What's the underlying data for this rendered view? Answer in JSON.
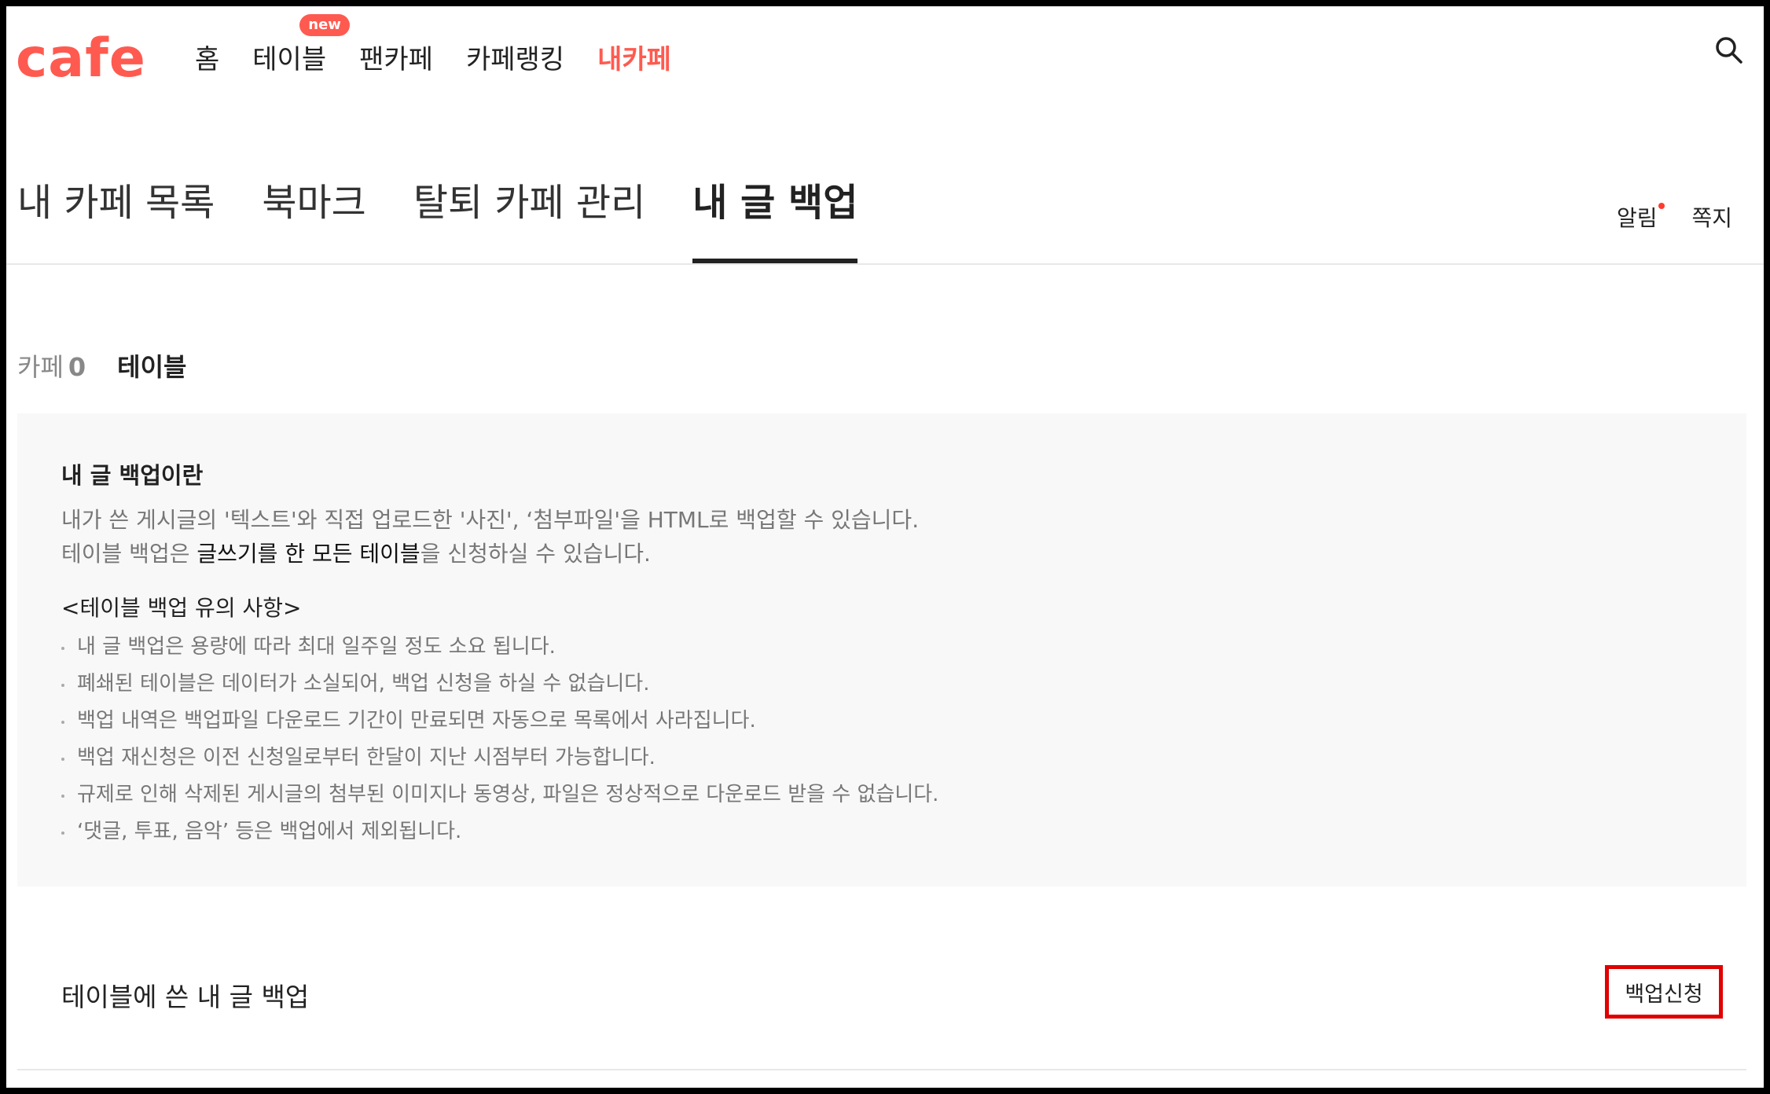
{
  "header": {
    "logo": "cafe",
    "nav": [
      {
        "label": "홈",
        "name": "nav-home"
      },
      {
        "label": "테이블",
        "name": "nav-table",
        "badge": "new"
      },
      {
        "label": "팬카페",
        "name": "nav-fancafe"
      },
      {
        "label": "카페랭킹",
        "name": "nav-cafe-ranking"
      },
      {
        "label": "내카페",
        "name": "nav-my-cafe",
        "active": true
      }
    ],
    "search_icon": "search-icon"
  },
  "tabs": [
    {
      "label": "내 카페 목록"
    },
    {
      "label": "북마크"
    },
    {
      "label": "탈퇴 카페 관리"
    },
    {
      "label": "내 글 백업",
      "active": true
    }
  ],
  "util": {
    "notice": "알림",
    "message": "쪽지"
  },
  "subtabs": {
    "cafe": {
      "label": "카페",
      "count": "0"
    },
    "table": {
      "label": "테이블",
      "active": true
    }
  },
  "info": {
    "title": "내 글 백업이란",
    "desc1": "내가 쓴 게시글의 '텍스트'와 직접 업로드한 '사진', ‘첨부파일'을 HTML로 백업할 수 있습니다.",
    "desc2_pre": "테이블 백업은 ",
    "desc2_bold": "글쓰기를 한 모든 테이블",
    "desc2_post": "을 신청하실 수 있습니다.",
    "notice_title": "<테이블 백업 유의 사항>",
    "notices": [
      "내 글 백업은 용량에 따라 최대 일주일 정도 소요 됩니다.",
      "폐쇄된 테이블은 데이터가 소실되어, 백업 신청을 하실 수 없습니다.",
      "백업 내역은 백업파일 다운로드 기간이 만료되면 자동으로 목록에서 사라집니다.",
      "백업 재신청은 이전 신청일로부터 한달이 지난 시점부터 가능합니다.",
      "규제로 인해 삭제된 게시글의 첨부된 이미지나 동영상, 파일은 정상적으로 다운로드 받을 수 없습니다.",
      "‘댓글, 투표, 음악’ 등은 백업에서 제외됩니다."
    ]
  },
  "backup": {
    "label": "테이블에 쓴 내 글 백업",
    "button": "백업신청"
  },
  "colors": {
    "brand": "#ff5a50",
    "highlight_border": "#e00000"
  }
}
